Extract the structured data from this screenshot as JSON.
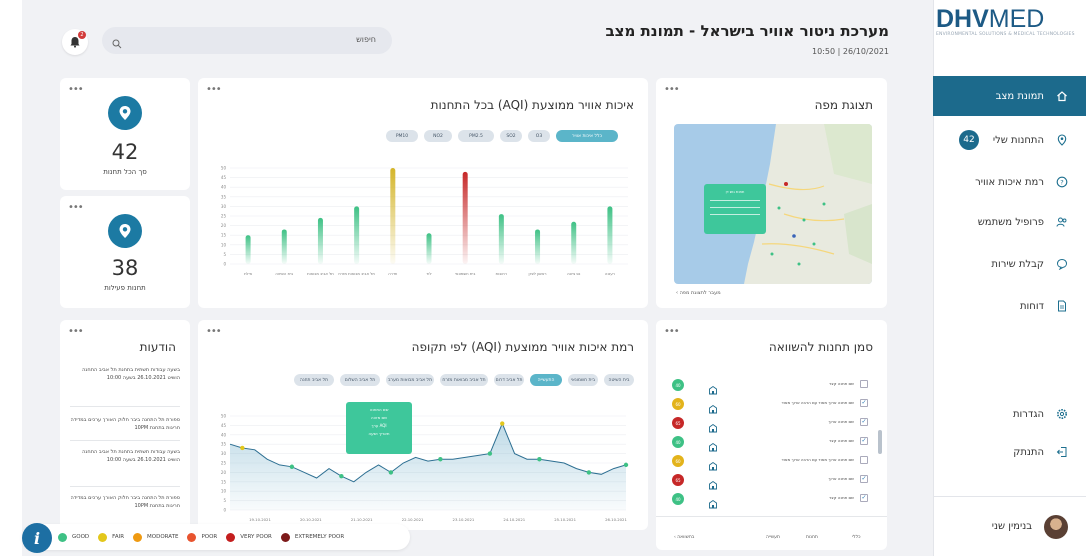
{
  "brand": {
    "name_bold": "DHV",
    "name_light": "MED",
    "tagline": "ENVIRONMENTAL SOLUTIONS & MEDICAL TECHNOLOGIES"
  },
  "header": {
    "title": "מערכת ניטור אוויר בישראל - תמונת מצב",
    "datetime": "10:50  |  26/10/2021",
    "search_label": "חיפוש",
    "bell_count": "2"
  },
  "sidebar": {
    "items": [
      {
        "label": "תמונת מצב",
        "icon": "home-icon",
        "active": true
      },
      {
        "label": "התחנות שלי",
        "icon": "location-icon",
        "badge": "42"
      },
      {
        "label": "רמת איכות אוויר",
        "icon": "question-icon"
      },
      {
        "label": "פרופיל משתמש",
        "icon": "users-icon"
      },
      {
        "label": "קבלת שירות",
        "icon": "chat-icon"
      },
      {
        "label": "דוחות",
        "icon": "document-icon"
      }
    ],
    "bottom_items": [
      {
        "label": "הגדרות",
        "icon": "gear-icon"
      },
      {
        "label": "התנתק",
        "icon": "logout-icon"
      }
    ],
    "user_name": "בנימין שני"
  },
  "stats": [
    {
      "value": "42",
      "label": "סך הכל תחנות"
    },
    {
      "value": "38",
      "label": "תחנות פעילות"
    }
  ],
  "aqi_stations": {
    "title": "איכות אוויר ממוצעת (AQI) בכל התחנות",
    "chips": [
      "PM10",
      "NO2",
      "PM2.5",
      "SO2",
      "O3",
      "כלל איכות אוויר"
    ],
    "active_chip": "כלל איכות אוויר"
  },
  "map_card": {
    "title": "תצוגת מפה",
    "popup_title": "תחנת גוש דן",
    "back_link": "מעבר לתצוגת מפה"
  },
  "aqi_period": {
    "title": "רמת איכות אוויר ממוצעת (AQI) לפי תקופה",
    "chips": [
      "תל אביב תחנה",
      "תל אביב השלום",
      "תל אביב מבואות מערב",
      "תל אביב מבואות מזרח",
      "תל אביב דרום",
      "התעשייה",
      "בית חשמונאי",
      "בית השיטה"
    ],
    "active_chip": "התעשייה",
    "tooltip_lines": [
      "שם התחנה",
      "שם מזהה",
      "ערך AQI",
      "תאריך ושעה"
    ]
  },
  "compare": {
    "title": "סמן תחנות להשוואה",
    "rows": [
      {
        "text": "שם תחנה קצר",
        "value": "40",
        "color": "#3ec185",
        "checked": false
      },
      {
        "text": "שם תחנה ארוך מאוד עם הרבה ארוך מאוד",
        "value": "60",
        "color": "#e3b31b",
        "checked": true
      },
      {
        "text": "שם תחנה ארוך",
        "value": "65",
        "color": "#c62828",
        "checked": true
      },
      {
        "text": "שם תחנה קצר",
        "value": "40",
        "color": "#3ec185",
        "checked": true
      },
      {
        "text": "שם תחנה ארוך מאוד עם הרבה ארוך מאוד",
        "value": "60",
        "color": "#e3b31b",
        "checked": false
      },
      {
        "text": "שם תחנה ארוך",
        "value": "65",
        "color": "#c62828",
        "checked": true
      },
      {
        "text": "שם תחנה קצר",
        "value": "40",
        "color": "#3ec185",
        "checked": true
      }
    ],
    "footer": [
      "כללי",
      "תחנות",
      "תעשייה",
      "בחשוואה"
    ]
  },
  "messages": {
    "title": "הודעות",
    "items": [
      "בשעה עבודות תשתית בתחנת תל אביב התחנה הושיט 26.10.2021 בשעה 10:00",
      "ספורת תל התחנה ביבר חלוק האורך ערכים במדידה חריגות בתחנת 10PM",
      "בשעה עבודות תשתית בתחנת תל אביב התחנה הושיט 26.10.2021 בשעה 10:00",
      "ספורת תל התחנה ביבר חלוק האורך ערכים במדידה חריגות בתחנת 10PM"
    ]
  },
  "legend": [
    {
      "label": "GOOD",
      "color": "#3ec185"
    },
    {
      "label": "FAIR",
      "color": "#e3c71b"
    },
    {
      "label": "MODORATE",
      "color": "#ef9a12"
    },
    {
      "label": "POOR",
      "color": "#e8542f"
    },
    {
      "label": "VERY POOR",
      "color": "#c41e1e"
    },
    {
      "label": "EXTREMELY POOR",
      "color": "#7d1a1a"
    }
  ],
  "info_label": "i",
  "chart_data": [
    {
      "type": "bar",
      "categories": [
        "רעננה",
        "נס ציונה",
        "ראשון לציון",
        "רחובות",
        "בית חשמונאי",
        "לוד",
        "חדרה",
        "תל אביב מבואות מזרח",
        "תל אביב מבואות",
        "בית השיטה",
        "אילת"
      ],
      "values": [
        30,
        22,
        18,
        26,
        48,
        16,
        50,
        30,
        24,
        18,
        15
      ],
      "colors": [
        "#3ec185",
        "#3ec185",
        "#3ec185",
        "#3ec185",
        "#c62828",
        "#3ec185",
        "#d4b52a",
        "#3ec185",
        "#3ec185",
        "#3ec185",
        "#3ec185"
      ],
      "ylim": [
        0,
        50
      ],
      "yticks": [
        0,
        5,
        10,
        15,
        20,
        25,
        30,
        35,
        40,
        45,
        50
      ]
    },
    {
      "type": "area",
      "series": [
        {
          "values": [
            35,
            33,
            32,
            27,
            24,
            23,
            20,
            17,
            22,
            18,
            15,
            20,
            24,
            20,
            25,
            28,
            26,
            27,
            27,
            28,
            29,
            30,
            46,
            30,
            27,
            27,
            26,
            25,
            22,
            20,
            19,
            22,
            24
          ]
        }
      ],
      "point_colors": {
        "1": "#e3c71b",
        "22": "#e3c71b"
      },
      "x_labels": [
        "19.10.2021",
        "20.10.2021",
        "21.10.2021",
        "22.10.2021",
        "23.10.2021",
        "24.10.2021",
        "25.10.2021",
        "26.10.2021"
      ],
      "ylim": [
        0,
        50
      ],
      "yticks": [
        0,
        5,
        10,
        15,
        20,
        25,
        30,
        35,
        40,
        45,
        50
      ]
    }
  ]
}
